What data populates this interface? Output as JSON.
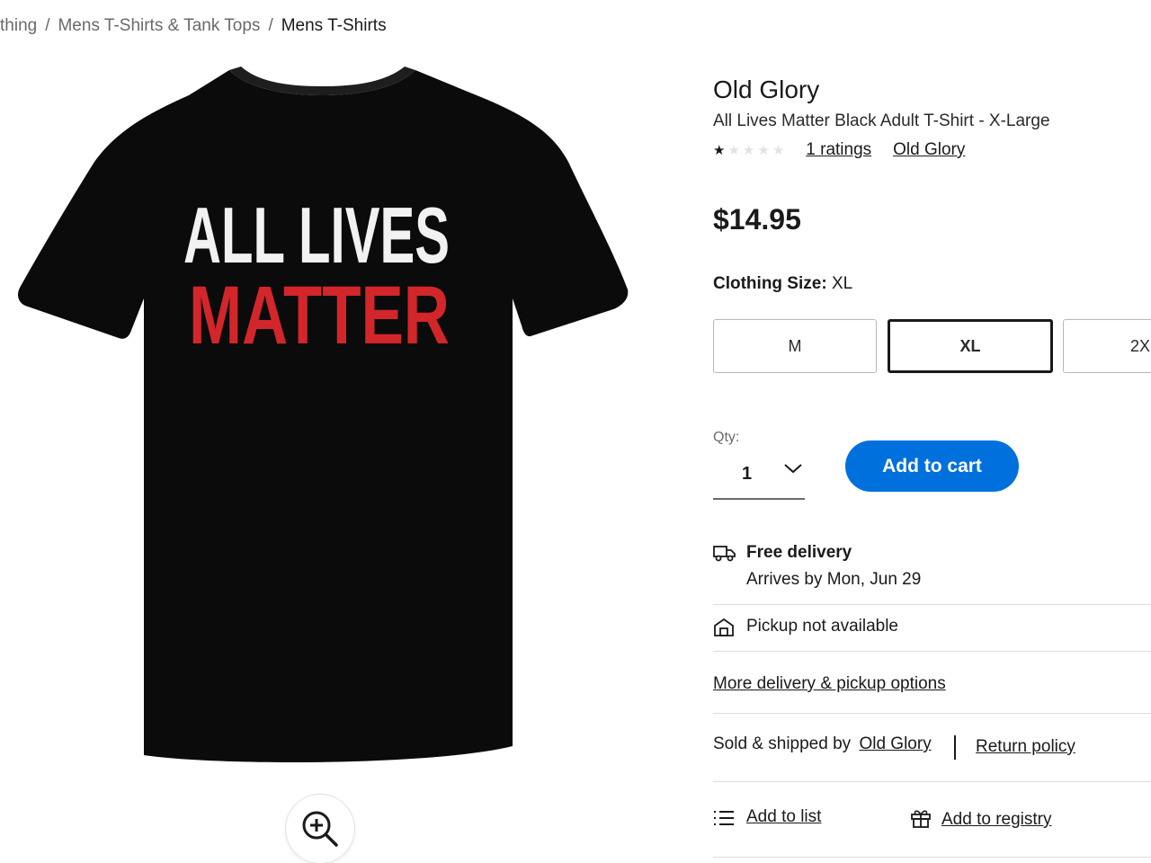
{
  "breadcrumb": {
    "items": [
      "thing",
      "Mens T-Shirts & Tank Tops"
    ],
    "current": "Mens T-Shirts",
    "separator": "/"
  },
  "product": {
    "image_text_line1": "ALL LIVES",
    "image_text_line2": "MATTER",
    "brand": "Old Glory",
    "title": "All Lives Matter Black Adult T-Shirt - X-Large",
    "rating": 1,
    "rating_max": 5,
    "ratings_link": "1 ratings",
    "brand_link": "Old Glory",
    "price": "$14.95"
  },
  "size": {
    "label": "Clothing Size:",
    "selected_value": "XL",
    "options": [
      "M",
      "XL",
      "2X"
    ]
  },
  "quantity": {
    "label": "Qty:",
    "value": "1"
  },
  "buttons": {
    "add_to_cart": "Add to cart",
    "add_to_list": "Add to list",
    "add_to_registry": "Add to registry"
  },
  "delivery": {
    "title": "Free delivery",
    "arrives": "Arrives by Mon, Jun 29",
    "pickup": "Pickup not available",
    "more_options": "More delivery & pickup options"
  },
  "seller": {
    "sold_label": "Sold & shipped by",
    "seller_name": "Old Glory",
    "return_policy": "Return policy"
  },
  "colors": {
    "accent_blue": "#0071dc",
    "shirt_black": "#0b0b0b",
    "print_red": "#d3262a",
    "print_white": "#f2f2f2"
  },
  "icons": [
    "truck-icon",
    "store-icon",
    "list-icon",
    "gift-icon",
    "zoom-in-icon",
    "chevron-down-icon",
    "star-icon"
  ]
}
